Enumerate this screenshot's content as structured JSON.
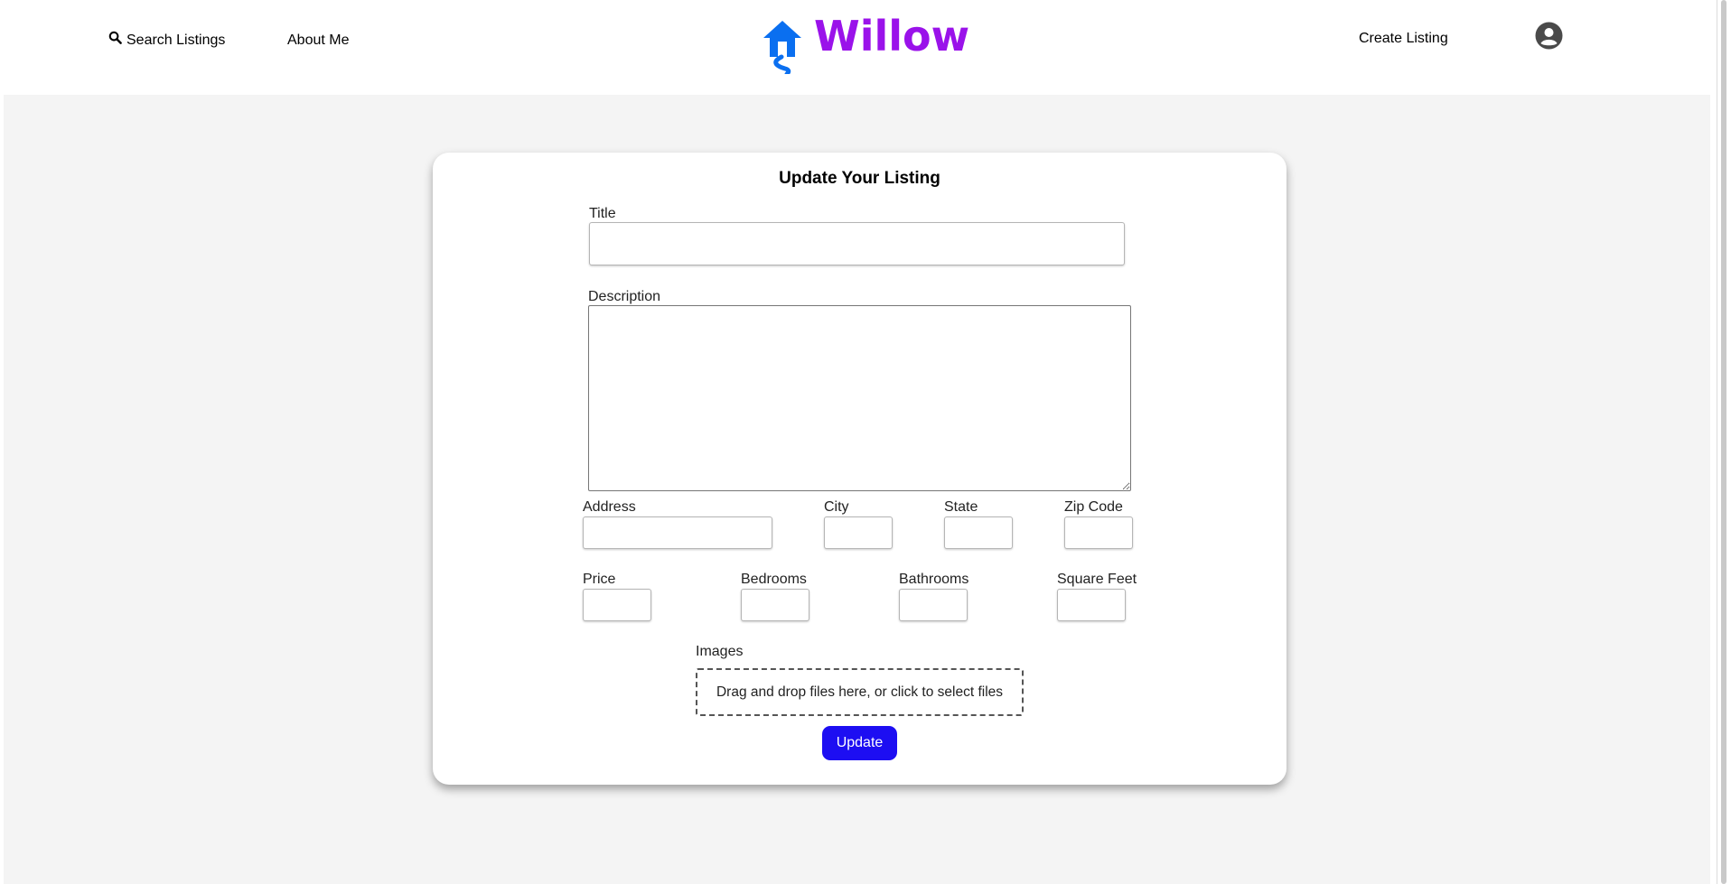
{
  "header": {
    "search_label": "Search Listings",
    "about_label": "About Me",
    "brand_name": "Willow",
    "create_label": "Create Listing",
    "brand_color": "#9a12ea",
    "logo_color": "#0a6ff0"
  },
  "form": {
    "title": "Update Your Listing",
    "fields": {
      "title_label": "Title",
      "description_label": "Description",
      "address_label": "Address",
      "city_label": "City",
      "state_label": "State",
      "zip_label": "Zip Code",
      "price_label": "Price",
      "bedrooms_label": "Bedrooms",
      "bathrooms_label": "Bathrooms",
      "sqft_label": "Square Feet",
      "images_label": "Images"
    },
    "values": {
      "title": "",
      "description": "",
      "address": "",
      "city": "",
      "state": "",
      "zip": "",
      "price": "",
      "bedrooms": "",
      "bathrooms": "",
      "sqft": ""
    },
    "dropzone_text": "Drag and drop files here, or click to select files",
    "submit_label": "Update",
    "submit_color": "#1d0ef2"
  }
}
